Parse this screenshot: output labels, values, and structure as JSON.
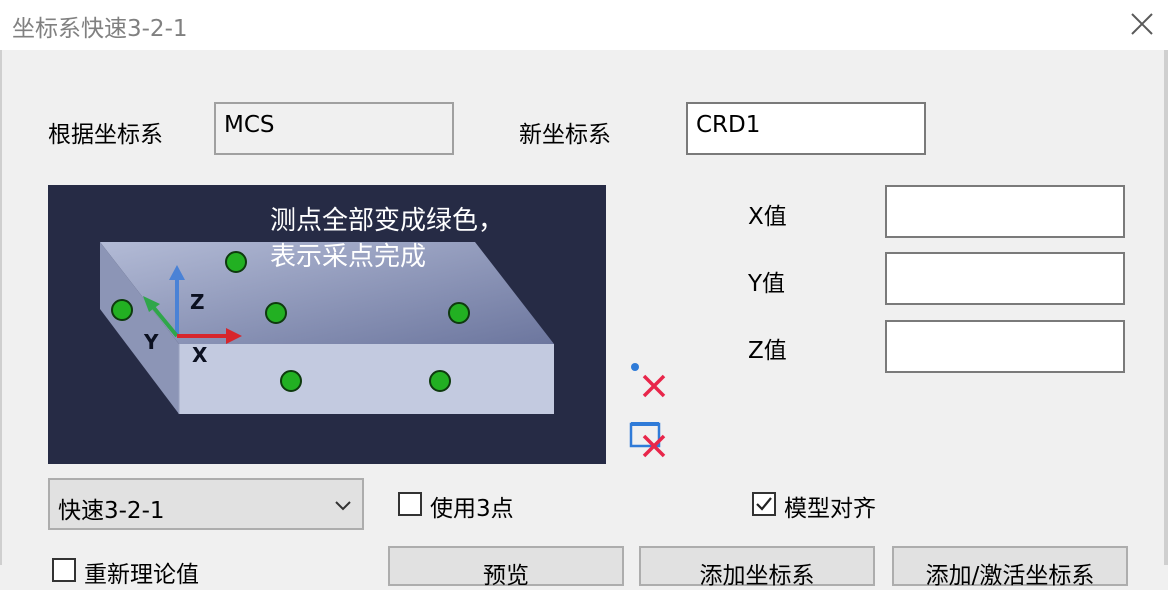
{
  "window": {
    "title": "坐标系快速3-2-1"
  },
  "form": {
    "base_label": "根据坐标系",
    "base_value": "MCS",
    "new_label": "新坐标系",
    "new_value": "CRD1",
    "x_label": "X值",
    "y_label": "Y值",
    "z_label": "Z值",
    "x_value": "",
    "y_value": "",
    "z_value": ""
  },
  "preview": {
    "hint_line1": "测点全部变成绿色，",
    "hint_line2": "表示采点完成",
    "axis_z": "Z",
    "axis_y": "Y",
    "axis_x": "X"
  },
  "controls": {
    "method_selected": "快速3-2-1",
    "use3points_label": "使用3点",
    "use3points_checked": false,
    "model_align_label": "模型对齐",
    "model_align_checked": true,
    "reset_theory_label": "重新理论值",
    "reset_theory_checked": false
  },
  "buttons": {
    "preview": "预览",
    "add": "添加坐标系",
    "add_activate": "添加/激活坐标系"
  },
  "colors": {
    "accent_green": "#22b022",
    "delete_red": "#e8264a",
    "preview_bg": "#262b45"
  },
  "icons": [
    "close-icon",
    "delete-point-icon",
    "clear-all-icon",
    "chevron-down-icon",
    "check-icon"
  ]
}
